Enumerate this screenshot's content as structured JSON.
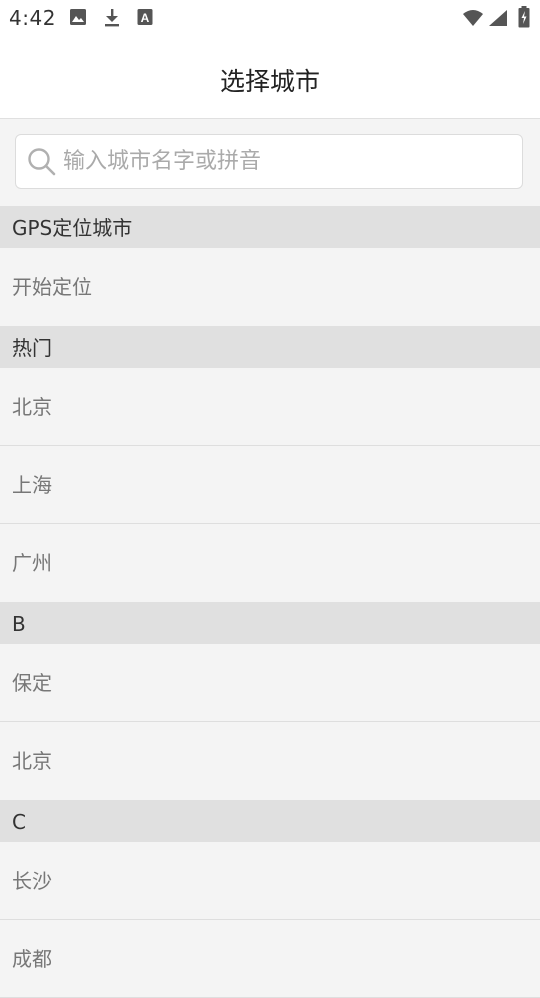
{
  "status_bar": {
    "time": "4:42",
    "icons": [
      "image-icon",
      "download-icon",
      "text-a-icon",
      "wifi-icon",
      "signal-icon",
      "battery-icon"
    ]
  },
  "header": {
    "title": "选择城市"
  },
  "search": {
    "placeholder": "输入城市名字或拼音",
    "value": ""
  },
  "sections": [
    {
      "header": "GPS定位城市",
      "items": [
        "开始定位"
      ]
    },
    {
      "header": "热门",
      "items": [
        "北京",
        "上海",
        "广州"
      ]
    },
    {
      "header": "B",
      "items": [
        "保定",
        "北京"
      ]
    },
    {
      "header": "C",
      "items": [
        "长沙",
        "成都"
      ]
    }
  ],
  "colors": {
    "background": "#f4f4f4",
    "section_header_bg": "#e0e0e0",
    "header_bg": "#ffffff",
    "item_text": "#777777",
    "title_text": "#222222"
  }
}
